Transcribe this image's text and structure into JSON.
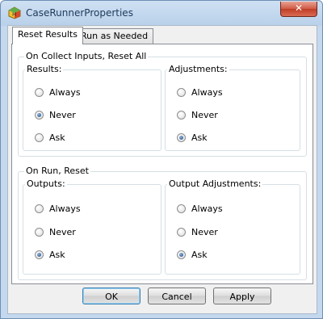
{
  "window": {
    "title": "CaseRunnerProperties",
    "close_label": "✕"
  },
  "tabs": [
    {
      "label": "Reset Results",
      "active": true
    },
    {
      "label": "Run as Needed",
      "active": false
    }
  ],
  "collect": {
    "title": "On Collect Inputs, Reset All",
    "results": {
      "title": "Results:",
      "options": [
        "Always",
        "Never",
        "Ask"
      ],
      "selected": "Never"
    },
    "adjustments": {
      "title": "Adjustments:",
      "options": [
        "Always",
        "Never",
        "Ask"
      ],
      "selected": "Ask"
    }
  },
  "run": {
    "title": "On Run, Reset",
    "outputs": {
      "title": "Outputs:",
      "options": [
        "Always",
        "Never",
        "Ask"
      ],
      "selected": "Ask"
    },
    "output_adjustments": {
      "title": "Output Adjustments:",
      "options": [
        "Always",
        "Never",
        "Ask"
      ],
      "selected": "Ask"
    }
  },
  "buttons": {
    "ok": "OK",
    "cancel": "Cancel",
    "apply": "Apply"
  },
  "icons": {
    "app": "app-icon",
    "close": "close-icon",
    "radio": "radio-icon"
  },
  "colors": {
    "title_text": "#1e395b",
    "close_red": "#c03d26",
    "radio_dot": "#1a4d86"
  }
}
